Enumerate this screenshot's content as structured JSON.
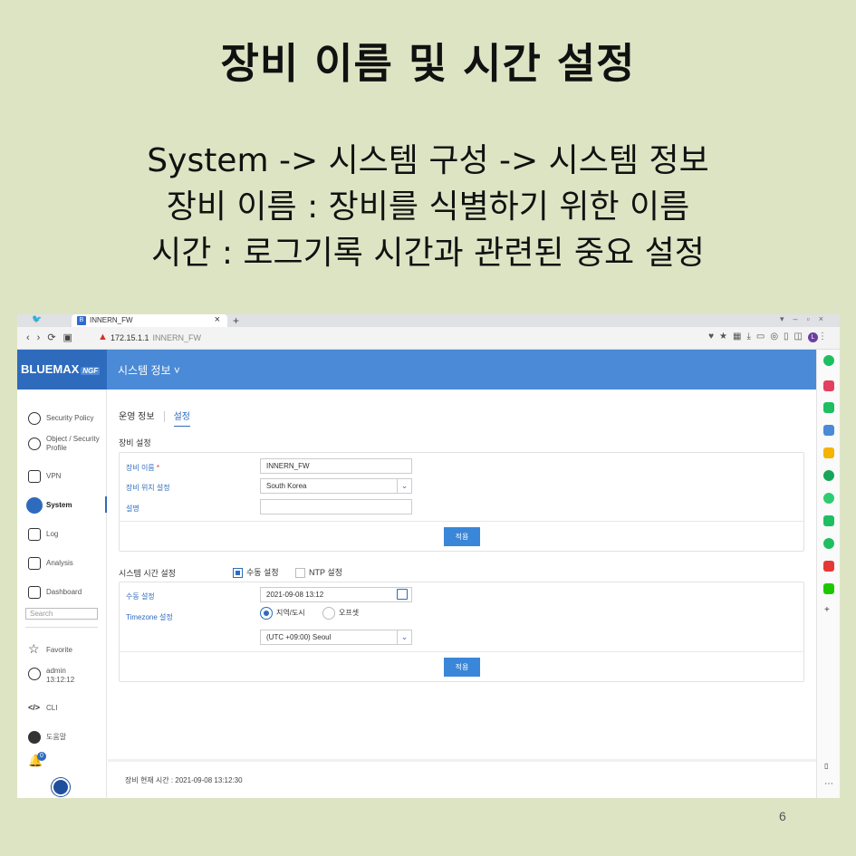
{
  "slide": {
    "title": "장비 이름 및 시간 설정",
    "lines": [
      "System -> 시스템 구성 -> 시스템 정보",
      "장비 이름 : 장비를 식별하기 위한 이름",
      "시간 : 로그기록 시간과 관련된 중요 설정"
    ],
    "page_number": "6"
  },
  "browser": {
    "tab_title": "INNERN_FW",
    "tab_close": "×",
    "new_tab": "+",
    "url_host": "172.15.1.1",
    "url_title": "INNERN_FW",
    "profile_initial": "L"
  },
  "app": {
    "logo": "BLUEMAX",
    "logo_badge": "NGF",
    "menu_title": "시스템 정보 ˅"
  },
  "sidebar": {
    "items": [
      {
        "label": "Security Policy"
      },
      {
        "label": "Object / Security Profile"
      },
      {
        "label": "VPN"
      },
      {
        "label": "System"
      },
      {
        "label": "Log"
      },
      {
        "label": "Analysis"
      },
      {
        "label": "Dashboard"
      }
    ],
    "search_placeholder": "Search",
    "lower_items": [
      {
        "label": "Favorite"
      },
      {
        "label": "admin 13:12:12"
      },
      {
        "label": "CLI"
      },
      {
        "label": "도움말"
      }
    ],
    "notification_count": "0"
  },
  "main": {
    "tabs": [
      {
        "label": "운영 정보",
        "active": false
      },
      {
        "label": "설정",
        "active": true
      }
    ],
    "device_section": {
      "title": "장비 설정",
      "name_label": "장비 이름",
      "required_mark": "*",
      "name_value": "INNERN_FW",
      "location_label": "장비 위치 설정",
      "location_value": "South Korea",
      "desc_label": "설명",
      "desc_value": "",
      "apply_label": "적용"
    },
    "time_section": {
      "title": "시스템 시간 설정",
      "manual_option": "수동 설정",
      "manual_checked": true,
      "ntp_option": "NTP 설정",
      "ntp_checked": false,
      "manual_label": "수동 설정",
      "datetime_value": "2021-09-08 13:12",
      "timezone_label": "Timezone 설정",
      "radio_region": "지역/도시",
      "radio_offset": "오프셋",
      "region_selected": true,
      "timezone_value": "(UTC +09:00) Seoul",
      "apply_label": "적용"
    }
  },
  "footer": {
    "text": "장비 현재 시간 : 2021-09-08 13:12:30"
  },
  "colors": {
    "accent": "#2e6bbd",
    "topbar": "#4a8ad6",
    "slide_bg": "#dde4c4"
  }
}
